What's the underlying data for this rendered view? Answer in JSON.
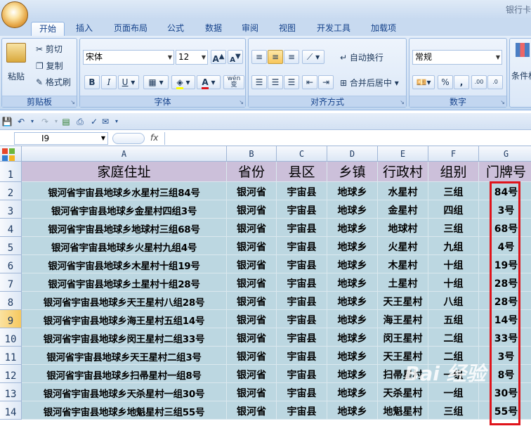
{
  "title_bar": {
    "title": "银行卡"
  },
  "tabs": [
    "开始",
    "插入",
    "页面布局",
    "公式",
    "数据",
    "审阅",
    "视图",
    "开发工具",
    "加载项"
  ],
  "ribbon": {
    "clipboard": {
      "paste": "粘贴",
      "cut": "剪切",
      "copy": "复制",
      "format_painter": "格式刷",
      "label": "剪贴板"
    },
    "font": {
      "name": "宋体",
      "size": "12",
      "bold": "B",
      "italic": "I",
      "underline": "U",
      "grow": "A",
      "shrink": "A",
      "label": "字体",
      "font_color_letter": "A",
      "phonetic": "wén 变"
    },
    "alignment": {
      "wrap": "自动换行",
      "merge": "合并后居中",
      "label": "对齐方式"
    },
    "number": {
      "format": "常规",
      "percent": "%",
      "comma": ",",
      "label": "数字"
    },
    "styles": {
      "conditional": "条件格"
    }
  },
  "formula_bar": {
    "name_box": "I9",
    "fx": "fx",
    "formula": ""
  },
  "columns": [
    "A",
    "B",
    "C",
    "D",
    "E",
    "F",
    "G"
  ],
  "rows": [
    "1",
    "2",
    "3",
    "4",
    "5",
    "6",
    "7",
    "8",
    "9",
    "10",
    "11",
    "12",
    "13",
    "14"
  ],
  "selected_row": "9",
  "header": [
    "家庭住址",
    "省份",
    "县区",
    "乡镇",
    "行政村",
    "组别",
    "门牌号"
  ],
  "data": [
    [
      "银河省宇宙县地球乡水星村三组84号",
      "银河省",
      "宇宙县",
      "地球乡",
      "水星村",
      "三组",
      "84号"
    ],
    [
      "银河省宇宙县地球乡金星村四组3号",
      "银河省",
      "宇宙县",
      "地球乡",
      "金星村",
      "四组",
      "3号"
    ],
    [
      "银河省宇宙县地球乡地球村三组68号",
      "银河省",
      "宇宙县",
      "地球乡",
      "地球村",
      "三组",
      "68号"
    ],
    [
      "银河省宇宙县地球乡火星村九组4号",
      "银河省",
      "宇宙县",
      "地球乡",
      "火星村",
      "九组",
      "4号"
    ],
    [
      "银河省宇宙县地球乡木星村十组19号",
      "银河省",
      "宇宙县",
      "地球乡",
      "木星村",
      "十组",
      "19号"
    ],
    [
      "银河省宇宙县地球乡土星村十组28号",
      "银河省",
      "宇宙县",
      "地球乡",
      "土星村",
      "十组",
      "28号"
    ],
    [
      "银河省宇宙县地球乡天王星村八组28号",
      "银河省",
      "宇宙县",
      "地球乡",
      "天王星村",
      "八组",
      "28号"
    ],
    [
      "银河省宇宙县地球乡海王星村五组14号",
      "银河省",
      "宇宙县",
      "地球乡",
      "海王星村",
      "五组",
      "14号"
    ],
    [
      "银河省宇宙县地球乡闵王星村二组33号",
      "银河省",
      "宇宙县",
      "地球乡",
      "闵王星村",
      "二组",
      "33号"
    ],
    [
      "银河省宇宙县地球乡天王星村二组3号",
      "银河省",
      "宇宙县",
      "地球乡",
      "天王星村",
      "二组",
      "3号"
    ],
    [
      "银河省宇宙县地球乡扫帚星村一组8号",
      "银河省",
      "宇宙县",
      "地球乡",
      "扫帚星村",
      "一组",
      "8号"
    ],
    [
      "银河省宇宙县地球乡天杀星村一组30号",
      "银河省",
      "宇宙县",
      "地球乡",
      "天杀星村",
      "一组",
      "30号"
    ],
    [
      "银河省宇宙县地球乡地魁星村三组55号",
      "银河省",
      "宇宙县",
      "地球乡",
      "地魁星村",
      "三组",
      "55号"
    ]
  ],
  "watermark": "Bai 经验",
  "colors": {
    "header_fill": "#ccc0da",
    "data_fill": "#bcd7e1",
    "highlight": "#e0141b",
    "ribbon": "#d2e1f4"
  }
}
